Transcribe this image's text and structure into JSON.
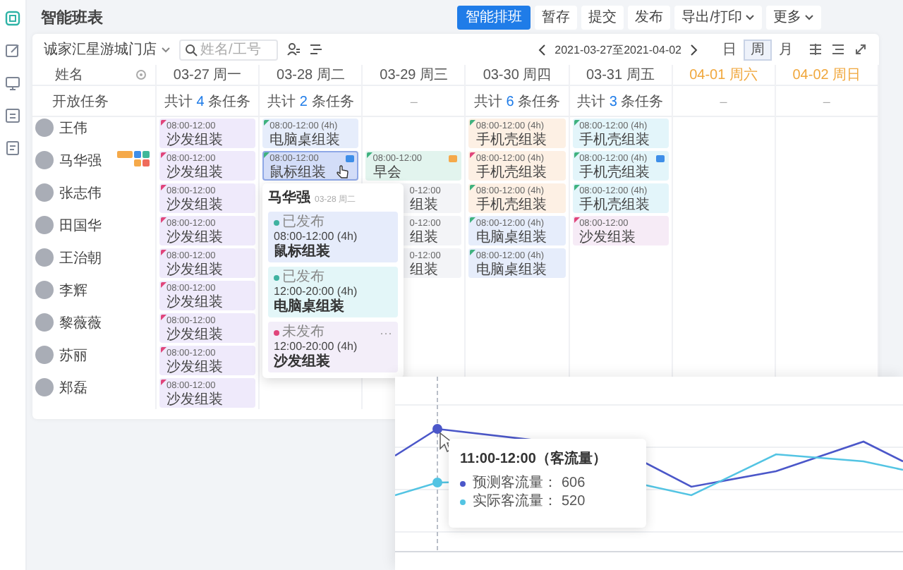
{
  "sidebar": {
    "items": [
      {
        "kind": "calendar",
        "selected": true
      },
      {
        "kind": "edit",
        "selected": false
      },
      {
        "kind": "monitor",
        "selected": false
      },
      {
        "kind": "board",
        "selected": false
      },
      {
        "kind": "list",
        "selected": false
      }
    ]
  },
  "header": {
    "title": "智能班表",
    "actions": [
      {
        "label": "智能排班",
        "kind": "primary"
      },
      {
        "label": "暂存",
        "kind": "plain"
      },
      {
        "label": "提交",
        "kind": "plain"
      },
      {
        "label": "发布",
        "kind": "plain"
      },
      {
        "label": "导出/打印",
        "kind": "dropdown"
      },
      {
        "label": "更多",
        "kind": "dropdown"
      }
    ]
  },
  "toolbar": {
    "store": "诚家汇星游城门店",
    "search": {
      "placeholder": "姓名/工号"
    },
    "date_range": "2021-03-27至2021-04-02",
    "views": [
      {
        "label": "日",
        "selected": false
      },
      {
        "label": "周",
        "selected": true
      },
      {
        "label": "月",
        "selected": false
      }
    ]
  },
  "schedule": {
    "name_header": "姓名",
    "days": [
      {
        "label": "03-27 周一",
        "weekend": false
      },
      {
        "label": "03-28 周二",
        "weekend": false
      },
      {
        "label": "03-29 周三",
        "weekend": false
      },
      {
        "label": "03-30 周四",
        "weekend": false
      },
      {
        "label": "03-31 周五",
        "weekend": false
      },
      {
        "label": "04-01 周六",
        "weekend": true
      },
      {
        "label": "04-02 周日",
        "weekend": true
      }
    ],
    "open_tasks": {
      "label": "开放任务",
      "cells": [
        {
          "kind": "total",
          "prefix": "共计",
          "count": "4",
          "suffix": "条任务"
        },
        {
          "kind": "total",
          "prefix": "共计",
          "count": "2",
          "suffix": "条任务"
        },
        {
          "kind": "empty",
          "text": "–"
        },
        {
          "kind": "total",
          "prefix": "共计",
          "count": "6",
          "suffix": "条任务"
        },
        {
          "kind": "total",
          "prefix": "共计",
          "count": "3",
          "suffix": "条任务"
        },
        {
          "kind": "empty",
          "text": "–"
        },
        {
          "kind": "empty",
          "text": "–"
        }
      ]
    },
    "employees": [
      {
        "name": "王伟",
        "shifts": [
          {
            "kind": "full",
            "time": "08:00-12:00",
            "task": "沙发组装",
            "color": "#efeafb",
            "published": false,
            "selected": false
          },
          {
            "kind": "full",
            "time": "08:00-12:00 (4h)",
            "task": "电脑桌组装",
            "color": "#e6edfb",
            "published": true,
            "selected": false
          },
          {
            "kind": "none"
          },
          {
            "kind": "full",
            "time": "08:00-12:00 (4h)",
            "task": "手机壳组装",
            "color": "#fdf0e4",
            "published": true,
            "selected": false
          },
          {
            "kind": "full",
            "time": "08:00-12:00 (4h)",
            "task": "手机壳组装",
            "color": "#e3f5fa",
            "published": true,
            "selected": false
          },
          {
            "kind": "none"
          },
          {
            "kind": "none"
          }
        ]
      },
      {
        "name": "马华强",
        "badges": [
          {
            "kind": "tag",
            "color": "#f5a94a"
          },
          {
            "kind": "chip",
            "color": "#3e8ee8"
          },
          {
            "kind": "chip",
            "color": "#3fb89a"
          },
          {
            "kind": "chip",
            "color": "#f5a94a"
          },
          {
            "kind": "chip",
            "color": "#ef6b5b"
          }
        ],
        "shifts": [
          {
            "kind": "full",
            "time": "08:00-12:00",
            "task": "沙发组装",
            "color": "#efeafb",
            "published": false,
            "selected": false
          },
          {
            "kind": "full",
            "time": "08:00-12:00",
            "task": "鼠标组装",
            "color": "#d3ddf8",
            "published": true,
            "selected": true,
            "tag": {
              "color": "#3e8ee8"
            }
          },
          {
            "kind": "full",
            "time": "08:00-12:00",
            "task": "早会",
            "color": "#e2f4ee",
            "published": true,
            "selected": false,
            "tag": {
              "color": "#f5a94a"
            }
          },
          {
            "kind": "full",
            "time": "08:00-12:00 (4h)",
            "task": "手机壳组装",
            "color": "#fdf0e4",
            "published": false,
            "selected": false
          },
          {
            "kind": "full",
            "time": "08:00-12:00 (4h)",
            "task": "手机壳组装",
            "color": "#e3f5fa",
            "published": true,
            "selected": false,
            "tag": {
              "color": "#3e8ee8"
            }
          },
          {
            "kind": "none"
          },
          {
            "kind": "none"
          }
        ]
      },
      {
        "name": "张志伟",
        "shifts": [
          {
            "kind": "full",
            "time": "08:00-12:00",
            "task": "沙发组装",
            "color": "#efeafb",
            "published": false,
            "selected": false
          },
          {
            "kind": "covered"
          },
          {
            "kind": "partial",
            "time": "0-12:00",
            "task": "组装",
            "color": "#f3f4f7"
          },
          {
            "kind": "full",
            "time": "08:00-12:00 (4h)",
            "task": "手机壳组装",
            "color": "#fdf0e4",
            "published": true,
            "selected": false
          },
          {
            "kind": "full",
            "time": "08:00-12:00 (4h)",
            "task": "手机壳组装",
            "color": "#e3f5fa",
            "published": true,
            "selected": false
          },
          {
            "kind": "none"
          },
          {
            "kind": "none"
          }
        ]
      },
      {
        "name": "田国华",
        "shifts": [
          {
            "kind": "full",
            "time": "08:00-12:00",
            "task": "沙发组装",
            "color": "#efeafb",
            "published": false,
            "selected": false
          },
          {
            "kind": "covered"
          },
          {
            "kind": "partial",
            "time": "0-12:00",
            "task": "组装",
            "color": "#f3f4f7"
          },
          {
            "kind": "full",
            "time": "08:00-12:00 (4h)",
            "task": "电脑桌组装",
            "color": "#e6edfb",
            "published": true,
            "selected": false
          },
          {
            "kind": "full",
            "time": "08:00-12:00",
            "task": "沙发组装",
            "color": "#f6ebf6",
            "published": false,
            "selected": false
          },
          {
            "kind": "none"
          },
          {
            "kind": "none"
          }
        ]
      },
      {
        "name": "王治朝",
        "shifts": [
          {
            "kind": "full",
            "time": "08:00-12:00",
            "task": "沙发组装",
            "color": "#efeafb",
            "published": false,
            "selected": false
          },
          {
            "kind": "covered"
          },
          {
            "kind": "partial",
            "time": "0-12:00",
            "task": "组装",
            "color": "#f3f4f7"
          },
          {
            "kind": "full",
            "time": "08:00-12:00 (4h)",
            "task": "电脑桌组装",
            "color": "#e6edfb",
            "published": true,
            "selected": false
          },
          {
            "kind": "none"
          },
          {
            "kind": "none"
          },
          {
            "kind": "none"
          }
        ]
      },
      {
        "name": "李辉",
        "shifts": [
          {
            "kind": "full",
            "time": "08:00-12:00",
            "task": "沙发组装",
            "color": "#efeafb",
            "published": false,
            "selected": false
          },
          {
            "kind": "covered"
          },
          {
            "kind": "none"
          },
          {
            "kind": "none"
          },
          {
            "kind": "none"
          },
          {
            "kind": "none"
          },
          {
            "kind": "none"
          }
        ]
      },
      {
        "name": "黎薇薇",
        "shifts": [
          {
            "kind": "full",
            "time": "08:00-12:00",
            "task": "沙发组装",
            "color": "#efeafb",
            "published": false,
            "selected": false
          },
          {
            "kind": "none"
          },
          {
            "kind": "none"
          },
          {
            "kind": "none"
          },
          {
            "kind": "none"
          },
          {
            "kind": "none"
          },
          {
            "kind": "none"
          }
        ]
      },
      {
        "name": "苏丽",
        "shifts": [
          {
            "kind": "full",
            "time": "08:00-12:00",
            "task": "沙发组装",
            "color": "#efeafb",
            "published": false,
            "selected": false
          },
          {
            "kind": "none"
          },
          {
            "kind": "none"
          },
          {
            "kind": "none"
          },
          {
            "kind": "none"
          },
          {
            "kind": "none"
          },
          {
            "kind": "none"
          }
        ]
      },
      {
        "name": "郑磊",
        "shifts": [
          {
            "kind": "full",
            "time": "08:00-12:00",
            "task": "沙发组装",
            "color": "#efeafb",
            "published": false,
            "selected": false
          },
          {
            "kind": "none"
          },
          {
            "kind": "none"
          },
          {
            "kind": "none"
          },
          {
            "kind": "none"
          },
          {
            "kind": "none"
          },
          {
            "kind": "none"
          }
        ]
      }
    ]
  },
  "popover": {
    "name": "马华强",
    "date": "03-28 周二",
    "entries": [
      {
        "status": "已发布",
        "published": true,
        "time": "08:00-12:00 (4h)",
        "task": "鼠标组装",
        "color": "#e6ecfb"
      },
      {
        "status": "已发布",
        "published": true,
        "time": "12:00-20:00 (4h)",
        "task": "电脑桌组装",
        "color": "#e3f6f8"
      },
      {
        "status": "未发布",
        "published": false,
        "time": "12:00-20:00 (4h)",
        "task": "沙发组装",
        "color": "#f3eef9",
        "more": "···"
      }
    ]
  },
  "chart_panel": {
    "tooltip": {
      "title": "11:00-12:00（客流量）",
      "items": [
        {
          "label": "预测客流量：",
          "value": "606",
          "color": "#4b57c9"
        },
        {
          "label": "实际客流量：",
          "value": "520",
          "color": "#53c4e3"
        }
      ]
    }
  }
}
